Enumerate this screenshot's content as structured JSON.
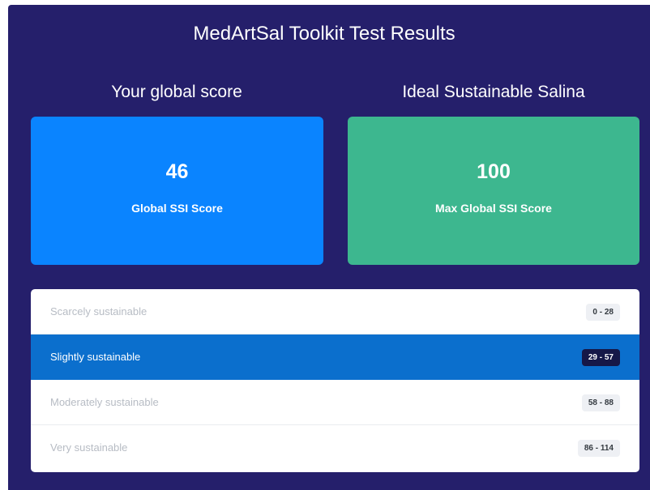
{
  "page": {
    "title": "MedArtSal Toolkit Test Results"
  },
  "columns": {
    "left_title": "Your global score",
    "right_title": "Ideal Sustainable Salina"
  },
  "cards": {
    "global": {
      "value": "46",
      "label": "Global SSI Score",
      "color": "#0a84ff"
    },
    "max": {
      "value": "100",
      "label": "Max Global SSI Score",
      "color": "#3db78f"
    }
  },
  "levels": [
    {
      "name": "Scarcely sustainable",
      "range": "0 - 28",
      "active": false
    },
    {
      "name": "Slightly sustainable",
      "range": "29 - 57",
      "active": true
    },
    {
      "name": "Moderately sustainable",
      "range": "58 - 88",
      "active": false
    },
    {
      "name": "Very sustainable",
      "range": "86 - 114",
      "active": false
    }
  ],
  "colors": {
    "panel_bg": "#251f6b",
    "active_row": "#0b6fcd",
    "active_badge": "#161848"
  }
}
